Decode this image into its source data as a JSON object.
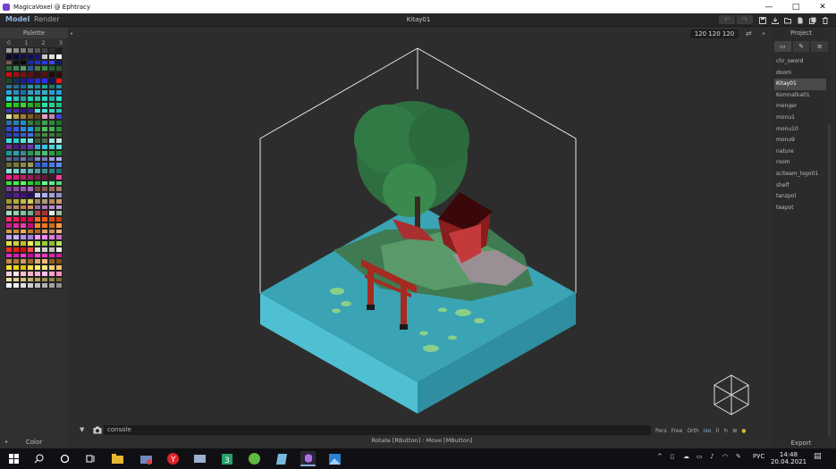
{
  "window": {
    "title": "MagicaVoxel @ Ephtracy",
    "minimize_glyph": "—",
    "maximize_glyph": "□",
    "close_glyph": "✕"
  },
  "menubar": {
    "model_label": "Model",
    "render_label": "Render",
    "document_title": "Kitay01",
    "undo_glyph": "↶",
    "redo_glyph": "↷"
  },
  "palette": {
    "header": "Palette",
    "column_numbers": [
      "0",
      "1",
      "2",
      "3"
    ],
    "footer": "Color",
    "colors": [
      "#9e9e9e",
      "#8a8a8a",
      "#7a7a7a",
      "#6a6a6a",
      "#555555",
      "#444444",
      "#303030",
      "#1c1c1c",
      "#0a0a2a",
      "#0a0a3a",
      "#10104a",
      "#101060",
      "#141478",
      "#c8c8c8",
      "#e0e0e0",
      "#ffffff",
      "#7a5a5a",
      "#101010",
      "#0a0a0a",
      "#1a2aa0",
      "#1e32c8",
      "#2a3ce0",
      "#3a48ff",
      "#0a1a6a",
      "#2a6a3a",
      "#3c8a5a",
      "#5a9a6a",
      "#2a5a9a",
      "#4a7a3a",
      "#3a8a4a",
      "#1a6a2a",
      "#305830",
      "#d01010",
      "#a01010",
      "#801010",
      "#601010",
      "#3a1010",
      "#5a1010",
      "#200808",
      "#300a0a",
      "#1a4a2a",
      "#10305a",
      "#1a1aa0",
      "#2020c0",
      "#2a2ae0",
      "#3030ff",
      "#101070",
      "#ff1010",
      "#2a7aa0",
      "#2a6a8a",
      "#1a6aa0",
      "#2a9aa0",
      "#1a8a9a",
      "#2aa090",
      "#1a7a6a",
      "#2a8aa0",
      "#2aa0e0",
      "#2a8ac0",
      "#1a70b0",
      "#3a9ac0",
      "#2aa0d0",
      "#3ab0c0",
      "#2a9ad0",
      "#1aa0e0",
      "#2ae0e0",
      "#2ac0c0",
      "#2aa0a0",
      "#1ad0b0",
      "#2ac0b0",
      "#2ad0c0",
      "#1ab0b0",
      "#2ae0d0",
      "#1ae01a",
      "#2ac02a",
      "#3ad03a",
      "#2ab02a",
      "#1aa01a",
      "#2ae0a0",
      "#2ad090",
      "#1ac080",
      "#3a3ab0",
      "#4a2aa0",
      "#2a1a80",
      "#2a2a90",
      "#5ae0e0",
      "#4ae0d0",
      "#3ad0c0",
      "#2ac0b0",
      "#e0e0a0",
      "#c0a040",
      "#a08030",
      "#806020",
      "#604010",
      "#e0a0c0",
      "#d080b0",
      "#4040e0",
      "#2a70a0",
      "#2a80b0",
      "#1a90c0",
      "#3a7a40",
      "#2a6a30",
      "#40a050",
      "#2a8a3a",
      "#1a7a2a",
      "#2a4ad0",
      "#3a5ae0",
      "#2a8ae0",
      "#1aa0e0",
      "#3a8a4a",
      "#50c060",
      "#40b050",
      "#2a9040",
      "#2a3ab0",
      "#2a4ac0",
      "#3a5ad0",
      "#4a6ae0",
      "#3a6a3a",
      "#4a8a4a",
      "#3a7a3a",
      "#2a6a2a",
      "#3ae0e0",
      "#2ad0d0",
      "#5ae0e0",
      "#7ae0e0",
      "#3a5a3a",
      "#507050",
      "#90e0e0",
      "#c0e0e0",
      "#7a2aa0",
      "#4a1a80",
      "#5a2a90",
      "#6a3ab0",
      "#2ab0e0",
      "#3ac0e0",
      "#4ad0e0",
      "#5ae0e0",
      "#1a9aa0",
      "#2aa0b0",
      "#3a8a90",
      "#2a9a50",
      "#3ab060",
      "#4ac070",
      "#2aa040",
      "#1a9030",
      "#5a6a9a",
      "#4a5a8a",
      "#6a7aaa",
      "#3a4a7a",
      "#8a8aca",
      "#7a7aba",
      "#9a9ada",
      "#aaaaea",
      "#6a6a2a",
      "#7a7a3a",
      "#8a8a4a",
      "#9a9a5a",
      "#2a5ad0",
      "#3a6ae0",
      "#4a7af0",
      "#5a8aff",
      "#8ae0e0",
      "#7ad0d0",
      "#6ac0c0",
      "#5ab0b0",
      "#4aa0a0",
      "#3a9090",
      "#2a8080",
      "#1a7070",
      "#ff1a8a",
      "#e01a7a",
      "#c01a6a",
      "#a01a5a",
      "#801a4a",
      "#601a3a",
      "#401a2a",
      "#ff3a9a",
      "#3ae03a",
      "#4af04a",
      "#5aff5a",
      "#2ad02a",
      "#1ac01a",
      "#6aff9a",
      "#5aef8a",
      "#4ade7a",
      "#7a3a9a",
      "#8a4aaa",
      "#9a5aba",
      "#aa6aca",
      "#7a4a3a",
      "#8a5a4a",
      "#9a6a5a",
      "#aa7a6a",
      "#3a1a7a",
      "#5a1a9a",
      "#4a0a8a",
      "#2a0a6a",
      "#c0c0ff",
      "#b0b0ef",
      "#a0a0df",
      "#9090cf",
      "#a09a2a",
      "#b0aa3a",
      "#c0ba4a",
      "#d0ca5a",
      "#9a8a6a",
      "#aa9a7a",
      "#ba8a5a",
      "#ca9a6a",
      "#aa7a5a",
      "#ba8a6a",
      "#ca7a4a",
      "#da8a5a",
      "#9a6aaa",
      "#aa7aba",
      "#ba8aca",
      "#ca9ada",
      "#a0e0c0",
      "#90d0b0",
      "#80c0a0",
      "#70b090",
      "#c04040",
      "#b03030",
      "#e8e8e8",
      "#a0c0a0",
      "#ff2a6a",
      "#ef1a5a",
      "#df0a4a",
      "#cf0a3a",
      "#ff6a2a",
      "#ef5a1a",
      "#df4a0a",
      "#cf3a0a",
      "#d01a90",
      "#e02aa0",
      "#f03ab0",
      "#c00a80",
      "#ff8a2a",
      "#ef7a1a",
      "#df6a0a",
      "#ff9a3a",
      "#e09a4a",
      "#d08a3a",
      "#f0aa5a",
      "#c07a2a",
      "#b06a1a",
      "#e0a06a",
      "#d0905a",
      "#f0b07a",
      "#c0a0ff",
      "#d0b0ff",
      "#b090ef",
      "#a080df",
      "#ff9aff",
      "#ef8aef",
      "#df7adf",
      "#cf6acf",
      "#e0e04a",
      "#d0d03a",
      "#c0c02a",
      "#f0f05a",
      "#aae04a",
      "#9ad03a",
      "#8ac02a",
      "#bae05a",
      "#ff2a2a",
      "#ef1a1a",
      "#df0a0a",
      "#ff4a4a",
      "#e0e0e0",
      "#d0d0d0",
      "#c0c0c0",
      "#f0f0f0",
      "#e02ac0",
      "#d01ab0",
      "#f03ad0",
      "#c00aa0",
      "#ff4ad0",
      "#ef3ac0",
      "#df2ab0",
      "#cf1aa0",
      "#c08a4a",
      "#b07a3a",
      "#d09a5a",
      "#a06a2a",
      "#e0aa6a",
      "#f0ba7a",
      "#906020",
      "#805010",
      "#ffe02a",
      "#efd01a",
      "#dfc00a",
      "#ffe04a",
      "#fff06a",
      "#ffe08a",
      "#ffd07a",
      "#ffc06a",
      "#ffd0e0",
      "#ffe0f0",
      "#ffc0d0",
      "#ffb0c0",
      "#ffb0e0",
      "#ffc0f0",
      "#ffa0d0",
      "#ff90c0",
      "#f0e0a0",
      "#e0d090",
      "#d0c080",
      "#c0b070",
      "#b0a060",
      "#a09050",
      "#908040",
      "#807030",
      "#ffffff",
      "#f0f0f0",
      "#e0e0e0",
      "#d0d0d0",
      "#c0c0c0",
      "#b0b0b0",
      "#a0a0a0",
      "#909090"
    ]
  },
  "viewport": {
    "dimensions_readout": "120 120 120",
    "swap_glyph": "⇄",
    "collapse_left_glyph": "▸",
    "collapse_right_glyph": "◂"
  },
  "project": {
    "header": "Project",
    "items": [
      "chr_sword",
      "doom",
      "Kitay01",
      "Komnatka01",
      "menger",
      "monu1",
      "monu10",
      "monu9",
      "nature",
      "room",
      "sciteam_logo01",
      "shelf",
      "tanzpol",
      "teapot"
    ],
    "selected_index": 2,
    "export_label": "Export"
  },
  "console": {
    "chevron": "▼",
    "placeholder": "console"
  },
  "view_modes": {
    "pers": "Pers",
    "free": "Free",
    "orth": "Orth",
    "iso": "Iso",
    "zero": "0"
  },
  "status": {
    "hint": "Rotate [RButton] : Move [MButton]"
  },
  "taskbar": {
    "lang": "РУС",
    "time": "14:48",
    "date": "20.04.2021",
    "tray_chevron": "^"
  },
  "colors": {
    "accent": "#8fb7e0",
    "water": "#3aa3b4",
    "background": "#2d2d2d"
  }
}
